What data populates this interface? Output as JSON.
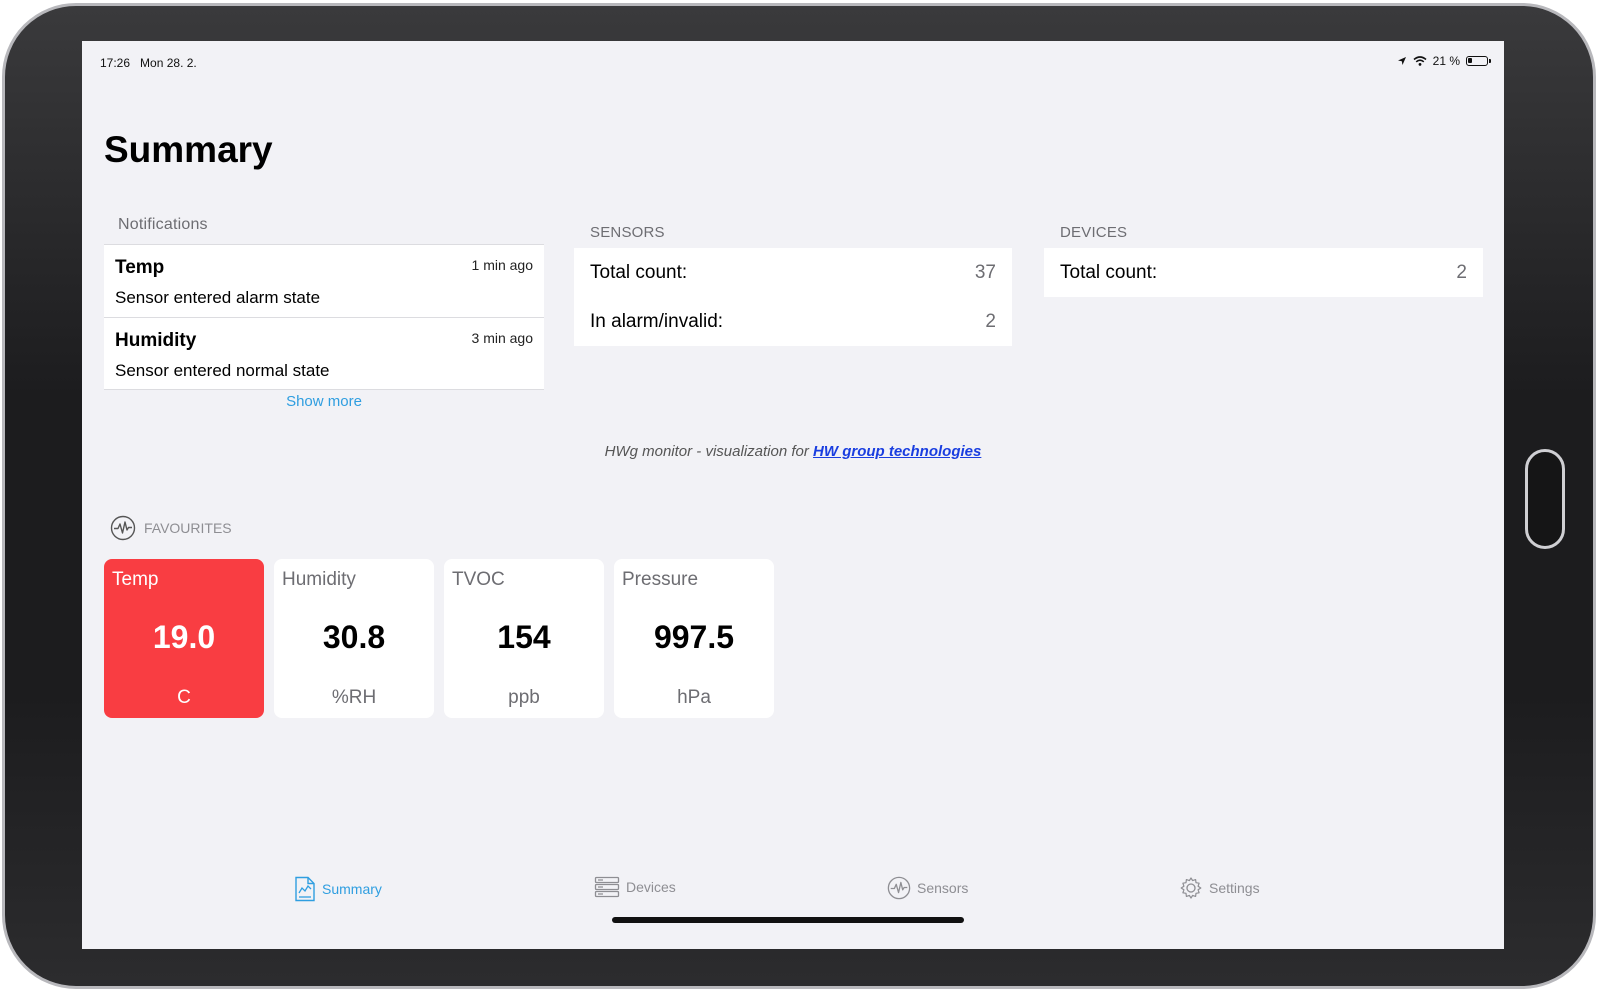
{
  "status_bar": {
    "time": "17:26",
    "date": "Mon 28. 2.",
    "battery": "21 %"
  },
  "page": {
    "title": "Summary"
  },
  "notifications": {
    "header": "Notifications",
    "items": [
      {
        "title": "Temp",
        "message": "Sensor entered alarm state",
        "ago": "1 min ago"
      },
      {
        "title": "Humidity",
        "message": "Sensor entered normal state",
        "ago": "3 min ago"
      }
    ],
    "show_more": "Show more"
  },
  "sensors": {
    "header": "SENSORS",
    "rows": [
      {
        "label": "Total count:",
        "value": "37"
      },
      {
        "label": "In alarm/invalid:",
        "value": "2"
      }
    ]
  },
  "devices": {
    "header": "DEVICES",
    "rows": [
      {
        "label": "Total count:",
        "value": "2"
      }
    ]
  },
  "footer": {
    "text": "HWg monitor - visualization for ",
    "link": "HW group technologies"
  },
  "favourites": {
    "header": "FAVOURITES",
    "tiles": [
      {
        "name": "Temp",
        "value": "19.0",
        "unit": "C",
        "alarm": true
      },
      {
        "name": "Humidity",
        "value": "30.8",
        "unit": "%RH",
        "alarm": false
      },
      {
        "name": "TVOC",
        "value": "154",
        "unit": "ppb",
        "alarm": false
      },
      {
        "name": "Pressure",
        "value": "997.5",
        "unit": "hPa",
        "alarm": false
      }
    ]
  },
  "tabbar": {
    "items": [
      {
        "label": "Summary",
        "icon": "document-chart-icon",
        "active": true
      },
      {
        "label": "Devices",
        "icon": "server-icon",
        "active": false
      },
      {
        "label": "Sensors",
        "icon": "pulse-icon",
        "active": false
      },
      {
        "label": "Settings",
        "icon": "gear-icon",
        "active": false
      }
    ]
  },
  "colors": {
    "accent": "#2f9ee0",
    "alarm": "#f93d42",
    "link": "#1a3ee0",
    "background": "#f2f2f6"
  }
}
